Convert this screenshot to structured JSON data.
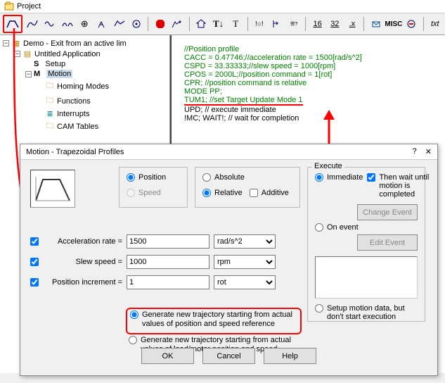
{
  "window_title": "Project",
  "toolbar": {
    "icons": [
      "trapezoid",
      "sine",
      "wave",
      "dual-wave",
      "drive",
      "theta",
      "cam",
      "ref",
      "stop",
      "wave2",
      "home",
      "text",
      "time",
      "io",
      "registers",
      "memory",
      "u16",
      "u32",
      "u8",
      "event",
      "misc",
      "interrupt",
      "text-tool"
    ],
    "misc_label": "MISC",
    "txt_label": "txt"
  },
  "tree": {
    "root": "Demo - Exit from an active lim",
    "app": "Untitled Application",
    "setup_key": "S",
    "setup": "Setup",
    "motion_key": "M",
    "motion": "Motion",
    "homing": "Homing Modes",
    "functions": "Functions",
    "interrupts": "Interrupts",
    "cam": "CAM Tables"
  },
  "code": {
    "l1": "//Position profile",
    "l2": "CACC = 0.47746;//acceleration rate = 1500[rad/s^2]",
    "l3": "CSPD = 33.33333;//slew speed = 1000[rpm]",
    "l4": "CPOS = 2000L;//position command = 1[rot]",
    "l5": "CPR; //position command is relative",
    "l6": "MODE PP;",
    "l7": "TUM1; //set Target Update Mode 1",
    "l8": "UPD; // execute immediate",
    "l9": "!MC; WAIT!; // wait for completion"
  },
  "dialog": {
    "title": "Motion - Trapezoidal Profiles",
    "position": "Position",
    "speed": "Speed",
    "absolute": "Absolute",
    "relative": "Relative",
    "additive": "Additive",
    "accel_label": "Acceleration rate =",
    "accel_val": "1500",
    "accel_unit": "rad/s^2",
    "slew_label": "Slew speed =",
    "slew_val": "1000",
    "slew_unit": "rpm",
    "pos_label": "Position increment =",
    "pos_val": "1",
    "pos_unit": "rot",
    "gen1": "Generate new trajectory starting from actual values of position and speed reference",
    "gen2": "Generate new trajectory starting from actual values of load/motor position and speed",
    "exec_title": "Execute",
    "immediate": "Immediate",
    "then_wait": "Then wait until motion is completed",
    "on_event": "On event",
    "change_event": "Change Event",
    "edit_event": "Edit Event",
    "setup_only": "Setup motion data, but don't start execution",
    "ok": "OK",
    "cancel": "Cancel",
    "help": "Help"
  }
}
